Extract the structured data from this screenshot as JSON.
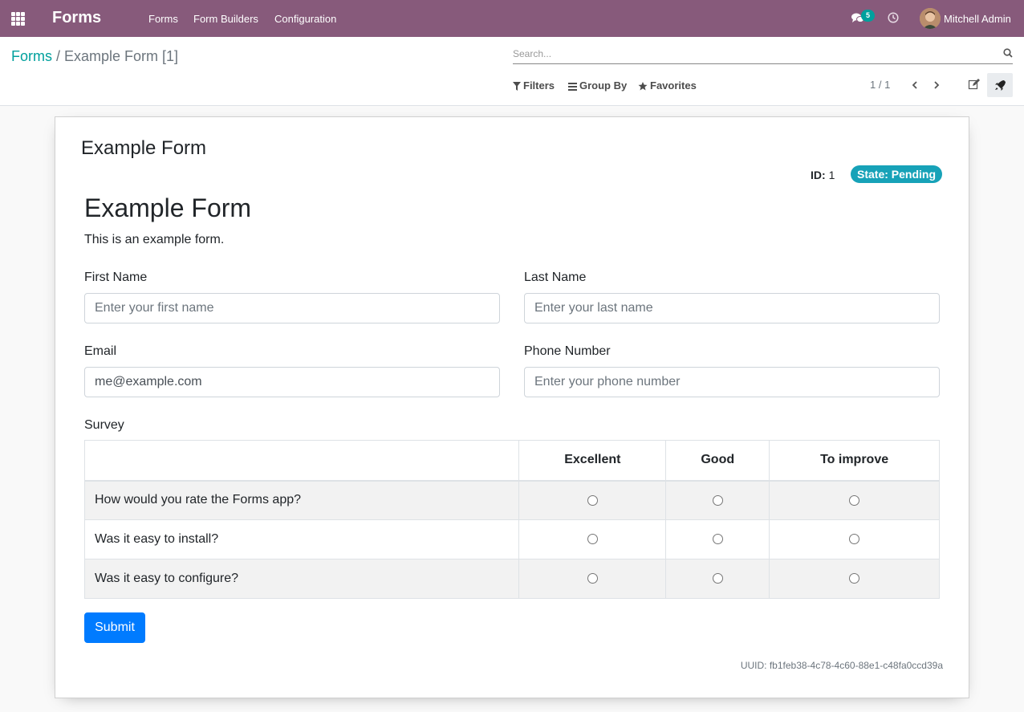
{
  "navbar": {
    "brand": "Forms",
    "menu": [
      "Forms",
      "Form Builders",
      "Configuration"
    ],
    "messages_count": "5",
    "user_name": "Mitchell Admin",
    "color": "#875a7b"
  },
  "control_panel": {
    "breadcrumb_parent": "Forms",
    "breadcrumb_separator": "/",
    "breadcrumb_current": "Example Form [1]",
    "search_placeholder": "Search...",
    "filters_label": "Filters",
    "group_by_label": "Group By",
    "favorites_label": "Favorites",
    "pager": "1 / 1"
  },
  "record": {
    "title": "Example Form",
    "id_label": "ID:",
    "id_value": "1",
    "state": "State: Pending",
    "uuid": "UUID: fb1feb38-4c78-4c60-88e1-c48fa0ccd39a"
  },
  "form": {
    "heading": "Example Form",
    "description": "This is an example form.",
    "fields": {
      "first_name": {
        "label": "First Name",
        "placeholder": "Enter your first name",
        "value": ""
      },
      "last_name": {
        "label": "Last Name",
        "placeholder": "Enter your last name",
        "value": ""
      },
      "email": {
        "label": "Email",
        "placeholder": "",
        "value": "me@example.com"
      },
      "phone": {
        "label": "Phone Number",
        "placeholder": "Enter your phone number",
        "value": ""
      }
    },
    "survey": {
      "label": "Survey",
      "columns": [
        "Excellent",
        "Good",
        "To improve"
      ],
      "questions": [
        "How would you rate the Forms app?",
        "Was it easy to install?",
        "Was it easy to configure?"
      ]
    },
    "submit_label": "Submit"
  }
}
